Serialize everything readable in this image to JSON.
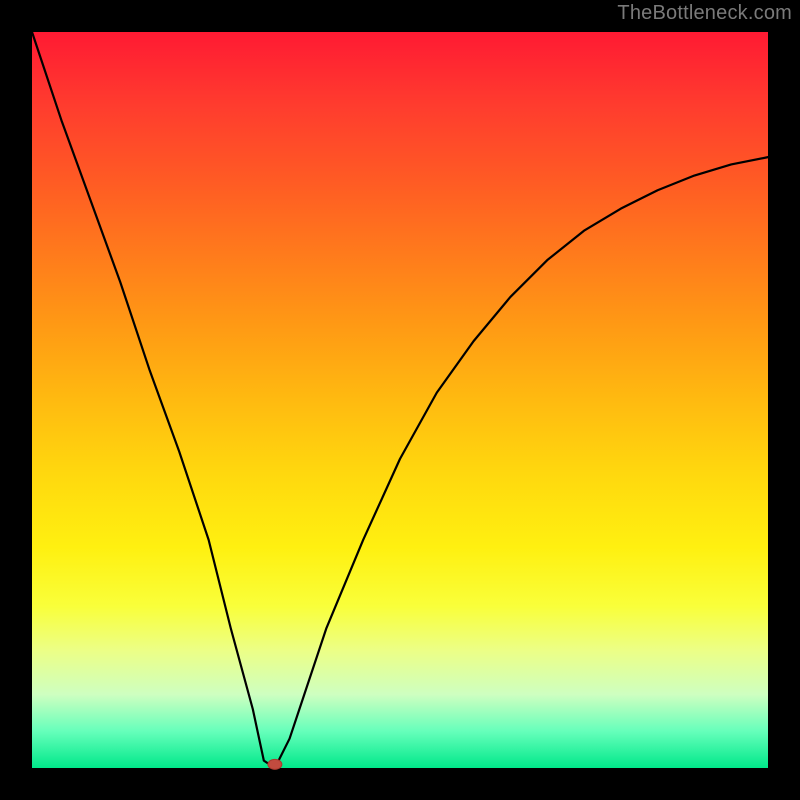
{
  "watermark": "TheBottleneck.com",
  "accent_marker_color": "#c24b3f",
  "chart_data": {
    "type": "line",
    "title": "",
    "xlabel": "",
    "ylabel": "",
    "xlim": [
      0,
      100
    ],
    "ylim": [
      0,
      100
    ],
    "grid": false,
    "series": [
      {
        "name": "bottleneck-curve",
        "x": [
          0,
          4,
          8,
          12,
          16,
          20,
          24,
          27,
          30,
          31.5,
          33,
          35,
          37,
          40,
          45,
          50,
          55,
          60,
          65,
          70,
          75,
          80,
          85,
          90,
          95,
          100
        ],
        "values": [
          100,
          88,
          77,
          66,
          54,
          43,
          31,
          19,
          8,
          1,
          0,
          4,
          10,
          19,
          31,
          42,
          51,
          58,
          64,
          69,
          73,
          76,
          78.5,
          80.5,
          82,
          83
        ]
      }
    ],
    "annotations": [
      {
        "type": "marker",
        "name": "optimal-point",
        "x": 33,
        "y": 0.5,
        "color": "#c24b3f"
      }
    ],
    "background_gradient": {
      "direction": "top-to-bottom",
      "stops": [
        {
          "pos": 0,
          "color": "#ff1a33"
        },
        {
          "pos": 50,
          "color": "#ffd80e"
        },
        {
          "pos": 100,
          "color": "#00e88a"
        }
      ]
    }
  }
}
